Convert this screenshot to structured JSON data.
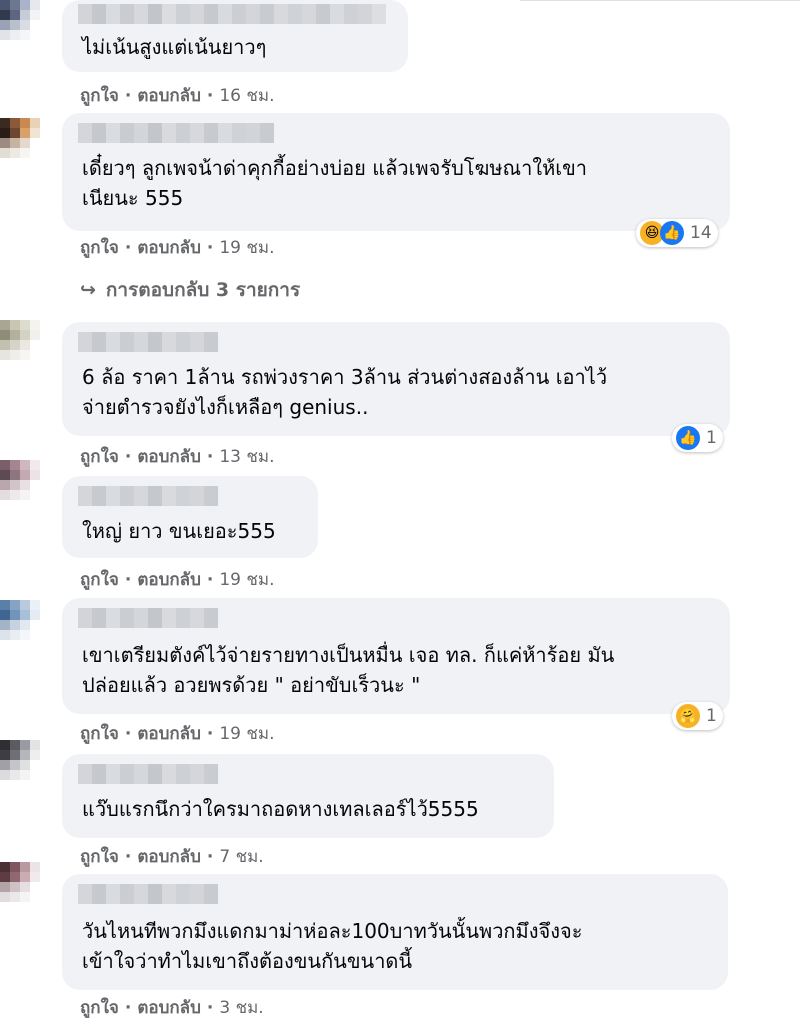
{
  "colors": {
    "bubble_bg": "#f0f2f5",
    "meta_text": "#65676b",
    "like_blue": "#1877f2"
  },
  "labels": {
    "like": "ถูกใจ",
    "separator": "·",
    "reply": "ตอบกลับ"
  },
  "comments": [
    {
      "lines": [
        "ไม่เน้นสูงแต่เน้นยาวๆ"
      ],
      "time": "16 ชม."
    },
    {
      "lines": [
        "เดี๋ยวๆ ลูกเพจน้าด่าคุกกี้อย่างบ่อย แล้วเพจรับโฆษณาให้เขา",
        "เนียนะ 555"
      ],
      "time": "19 ชม.",
      "reaction_icons": [
        "haha-icon",
        "like-icon"
      ],
      "reaction_count": "14",
      "replies_label": "การตอบกลับ 3 รายการ"
    },
    {
      "lines": [
        "6 ล้อ ราคา 1ล้าน รถพ่วงราคา 3ล้าน ส่วนต่างสองล้าน เอาไว้",
        "จ่ายตำรวจยังไงก็เหลือๆ genius.."
      ],
      "time": "13 ชม.",
      "reaction_icons": [
        "like-icon"
      ],
      "reaction_count": "1"
    },
    {
      "lines": [
        "ใหญ่ ยาว ขนเยอะ555"
      ],
      "time": "19 ชม."
    },
    {
      "lines": [
        "เขาเตรียมตังค์ไว้จ่ายรายทางเป็นหมื่น เจอ ทล. ก็แค่ห้าร้อย มัน",
        "ปล่อยแล้ว อวยพรด้วย \" อย่าขับเร็วนะ \""
      ],
      "time": "19 ชม.",
      "reaction_icons": [
        "care-icon"
      ],
      "reaction_count": "1"
    },
    {
      "lines": [
        "แว๊บแรกนึกว่าใครมาถอดหางเทลเลอร์ไว้5555"
      ],
      "time": "7 ชม."
    },
    {
      "lines": [
        "วันไหนทีพวกมึงแดกมาม่าห่อละ100บาทวันนั้นพวกมึงจึงจะ",
        "เข้าใจว่าทำไมเขาถึงต้องขนกันขนาดนี้"
      ],
      "time": "3 ชม."
    }
  ]
}
